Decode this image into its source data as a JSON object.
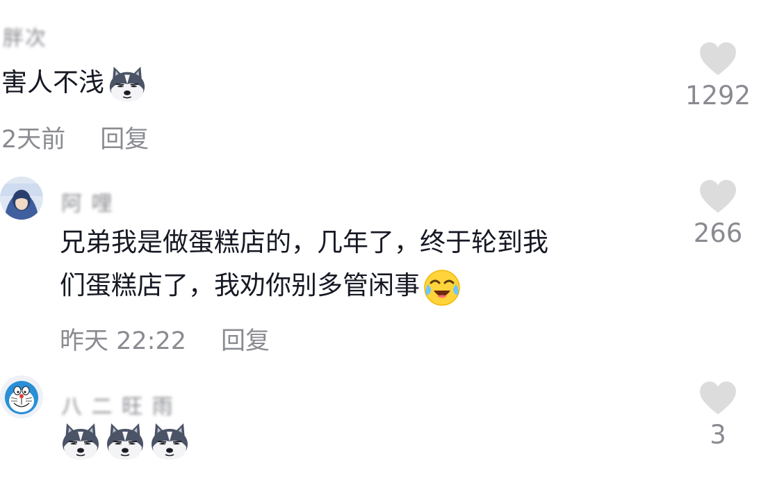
{
  "comments": [
    {
      "username": "胖次",
      "text": "害人不浅",
      "emojis": [
        "husky-emoji"
      ],
      "time": "2天前",
      "reply_label": "回复",
      "likes": "1292"
    },
    {
      "username": "阿 哩",
      "text_lines": [
        "兄弟我是做蛋糕店的，几年了，终于轮到我",
        "们蛋糕店了，我劝你别多管闲事"
      ],
      "emojis": [
        "crying-laughing-emoji"
      ],
      "time": "昨天 22:22",
      "reply_label": "回复",
      "likes": "266"
    },
    {
      "username": "八 二 旺 雨",
      "text": "",
      "emojis": [
        "husky-emoji",
        "husky-emoji",
        "husky-emoji"
      ],
      "likes": "3"
    }
  ],
  "colors": {
    "primary_text": "#161823",
    "secondary_text": "#8a8b91",
    "heart": "#dcdcdc",
    "background": "#ffffff"
  }
}
